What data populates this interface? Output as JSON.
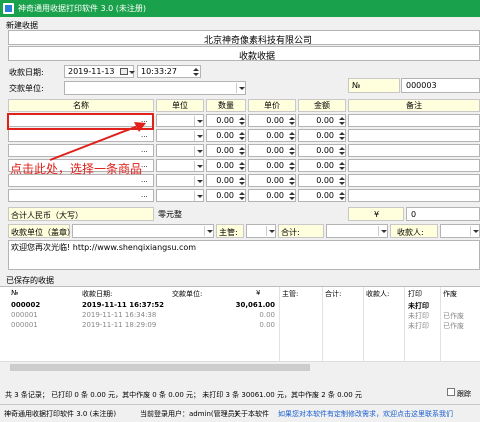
{
  "window": {
    "title": "神奇通用收据打印软件 3.0 (未注册)"
  },
  "menu": {
    "new_receipt": "新建收据"
  },
  "form": {
    "company": "北京神奇像素科技有限公司",
    "doc_title": "收款收据",
    "date_label": "收款日期:",
    "date_value": "2019-11-13",
    "time_value": "10:33:27",
    "payer_label": "交款单位:",
    "number_label": "№",
    "number_value": "000003",
    "columns": [
      "名称",
      "单位",
      "数量",
      "单价",
      "金额",
      "备注"
    ],
    "rows": [
      {
        "qty": "0.00",
        "price": "0.00",
        "amount": "0.00"
      },
      {
        "qty": "0.00",
        "price": "0.00",
        "amount": "0.00"
      },
      {
        "qty": "0.00",
        "price": "0.00",
        "amount": "0.00"
      },
      {
        "qty": "0.00",
        "price": "0.00",
        "amount": "0.00"
      },
      {
        "qty": "0.00",
        "price": "0.00",
        "amount": "0.00"
      },
      {
        "qty": "0.00",
        "price": "0.00",
        "amount": "0.00"
      }
    ],
    "ellipsis": "...",
    "total_cn_label": "合计人民币（大写）",
    "total_cn_value": "零元整",
    "yen_symbol": "¥",
    "total_num": "0",
    "sign_labels": [
      "收款单位（盖章）:",
      "主管:",
      "合计:",
      "收款人:"
    ],
    "footer_note": "欢迎您再次光临! http://www.shenqixiangsu.com"
  },
  "annotation": {
    "text": "点击此处，选择一条商品",
    "color": "#e0201a"
  },
  "saved": {
    "title": "已保存的收据",
    "headers": [
      "№",
      "收款日期:",
      "交款单位:",
      "¥",
      "主管:",
      "合计:",
      "收款人:",
      "打印",
      "作废"
    ],
    "rows": [
      {
        "no": "000002",
        "date": "2019-11-11 16:37:52",
        "amount": "30,061.00",
        "print": "未打印",
        "void": "",
        "bold": true
      },
      {
        "no": "000001",
        "date": "2019-11-11 16:34:38",
        "amount": "0.00",
        "print": "未打印",
        "void": "已作废",
        "bold": false
      },
      {
        "no": "000001",
        "date": "2019-11-11 18:29:09",
        "amount": "0.00",
        "print": "未打印",
        "void": "已作废",
        "bold": false
      }
    ]
  },
  "summary": {
    "text": "共 3 条记录；  已打印 0 条 0.00 元，其中作废 0 条 0.00 元；  未打印 3 条 30061.00 元，其中作废 2 条 0.00 元",
    "checkbox_label": "跟踪"
  },
  "status": {
    "app": "神奇通用收据打印软件 3.0 (未注册)",
    "user": "当前登录用户：admin(管理员)",
    "about": "关于本软件",
    "link": "如果您对本软件有定制修改需求，欢迎点击这里联系我们"
  }
}
